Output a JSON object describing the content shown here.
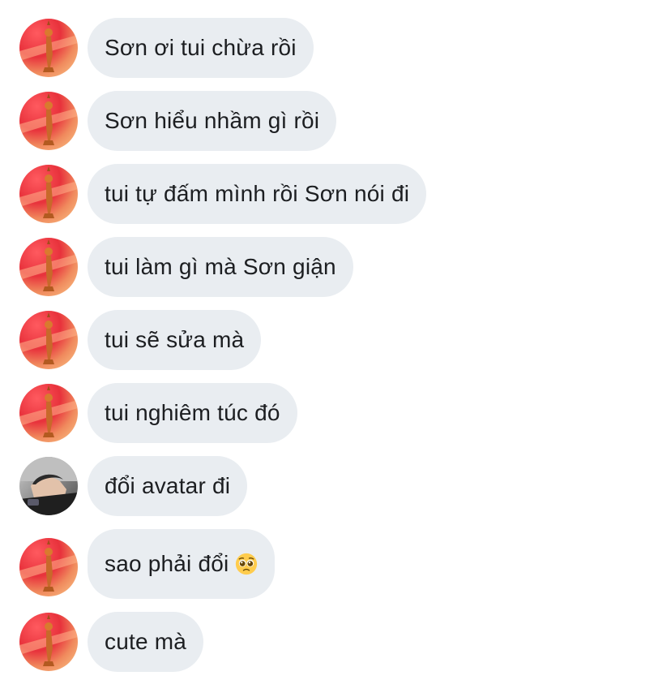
{
  "conversation": {
    "messages": [
      {
        "sender": "contact",
        "avatar": "red-figure-avatar",
        "text": "Sơn ơi tui chừa rồi"
      },
      {
        "sender": "contact",
        "avatar": "red-figure-avatar",
        "text": "Sơn hiểu nhầm gì rồi"
      },
      {
        "sender": "contact",
        "avatar": "red-figure-avatar",
        "text": "tui tự đấm mình rồi Sơn nói đi"
      },
      {
        "sender": "contact",
        "avatar": "red-figure-avatar",
        "text": "tui làm gì mà Sơn giận"
      },
      {
        "sender": "contact",
        "avatar": "red-figure-avatar",
        "text": "tui sẽ sửa mà"
      },
      {
        "sender": "contact",
        "avatar": "red-figure-avatar",
        "text": "tui nghiêm túc đó"
      },
      {
        "sender": "other",
        "avatar": "man-photo-avatar",
        "text": "đổi avatar đi"
      },
      {
        "sender": "contact",
        "avatar": "red-figure-avatar",
        "text": "sao phải đổi",
        "emoji": "pleading-face-emoji"
      },
      {
        "sender": "contact",
        "avatar": "red-figure-avatar",
        "text": "cute mà"
      }
    ]
  },
  "colors": {
    "bubble_bg": "#e9edf1",
    "text": "#1c1e21",
    "avatar_red": "#e8323c",
    "avatar_orange": "#f7a26b"
  }
}
